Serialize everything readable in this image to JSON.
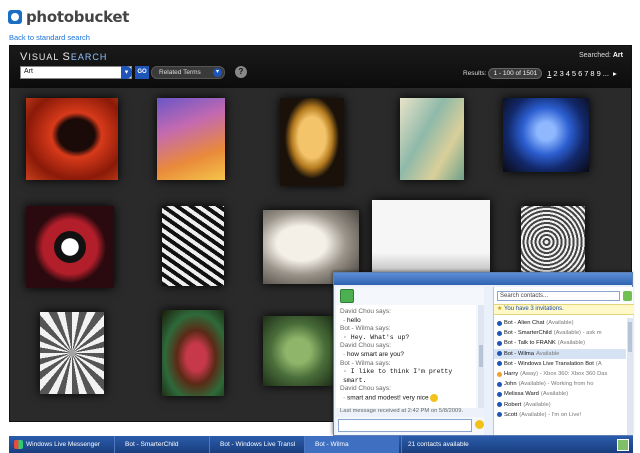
{
  "header": {
    "logo_text": "photobucket",
    "back_link": "Back to standard search"
  },
  "visual_search": {
    "logo_v": "V",
    "logo_rest": "ISUAL ",
    "logo_s": "S",
    "logo_earch": "EARCH",
    "searched_label": "Searched:",
    "searched_value": "Art",
    "search_value": "Art",
    "go_label": "GO",
    "related_label": "Related Terms",
    "help_label": "?",
    "results_label": "Results:",
    "results_range": "1 - 100 of 1501",
    "pages": [
      "1",
      "2",
      "3",
      "4",
      "5",
      "6",
      "7",
      "8",
      "9",
      "..."
    ],
    "next_label": "▸"
  },
  "messenger": {
    "chat": [
      {
        "name": "David Chou says:",
        "text": "hello",
        "mono": false
      },
      {
        "name": "Bot - Wilma says:",
        "text": "Hey. What's up?",
        "mono": true
      },
      {
        "name": "David Chou says:",
        "text": "how smart are you?",
        "mono": false
      },
      {
        "name": "Bot - Wilma says:",
        "text": "I like to think I'm pretty smart.",
        "mono": true
      },
      {
        "name": "David Chou says:",
        "text": "smart and modest! very nice",
        "mono": false
      }
    ],
    "last_message": "Last message received at 2:42 PM on 5/8/2009.",
    "contact_search_placeholder": "Search contacts...",
    "invitations": "You have 3 invitations.",
    "contacts": [
      {
        "name": "Bot - Alien Chat",
        "status": "(Available)",
        "away": false,
        "selected": false
      },
      {
        "name": "Bot - SmarterChild",
        "status": "(Available) - ask m",
        "away": false,
        "selected": false
      },
      {
        "name": "Bot - Talk to FRANK",
        "status": "(Available)",
        "away": false,
        "selected": false
      },
      {
        "name": "Bot - Wilma",
        "status": "Available",
        "away": false,
        "selected": true
      },
      {
        "name": "Bot - Windows Live Translation Bot",
        "status": "(A",
        "away": false,
        "selected": false
      },
      {
        "name": "Harry",
        "status": "(Away) - Xbox 360: Xbox 360 Das",
        "away": true,
        "selected": false
      },
      {
        "name": "John",
        "status": "(Available) - Working from ho",
        "away": false,
        "selected": false
      },
      {
        "name": "Melissa Ward",
        "status": "(Available)",
        "away": false,
        "selected": false
      },
      {
        "name": "Robert",
        "status": "(Available)",
        "away": false,
        "selected": false
      },
      {
        "name": "Scott",
        "status": "(Available) - I'm on Live!",
        "away": false,
        "selected": false
      }
    ]
  },
  "taskbar": {
    "wlm": "Windows Live Messenger",
    "items": [
      "Bot - SmarterChild",
      "Bot - Windows Live Transl",
      "Bot - Wilma"
    ],
    "contacts_available": "21 contacts available"
  },
  "colors": {
    "accent": "#1f55b8",
    "panel": "#222222",
    "link": "#1a73d9"
  }
}
